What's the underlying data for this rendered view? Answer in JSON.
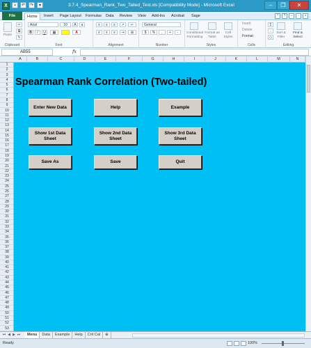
{
  "window": {
    "title": "3.7.4_Spearman_Rank_Two_Tailed_Test.xls  [Compatibility Mode]  -  Microsoft Excel",
    "app_icon": "X",
    "minimize": "–",
    "restore": "❐",
    "close": "✕"
  },
  "ribbon_tabs": [
    "File",
    "Home",
    "Insert",
    "Page Layout",
    "Formulas",
    "Data",
    "Review",
    "View",
    "Add-Ins",
    "Acrobat",
    "Sage"
  ],
  "ribbon": {
    "clipboard": {
      "label": "Clipboard",
      "paste": "Paste"
    },
    "font": {
      "label": "Font",
      "name": "Arial",
      "size": "10"
    },
    "alignment": {
      "label": "Alignment"
    },
    "number": {
      "label": "Number",
      "format": "General",
      "currency": "$",
      "percent": "%"
    },
    "styles": {
      "label": "Styles",
      "conditional": "Conditional\nFormatting",
      "format_table": "Format as\nTable",
      "cell_styles": "Cell\nStyles"
    },
    "cells": {
      "label": "Cells",
      "insert": "Insert",
      "delete": "Delete",
      "format": "Format"
    },
    "editing": {
      "label": "Editing",
      "sort": "Sort &\nFilter",
      "find": "Find &\nSelect"
    }
  },
  "formula_bar": {
    "name_box": "AB55",
    "fx": "fx",
    "value": ""
  },
  "columns": [
    "A",
    "B",
    "C",
    "D",
    "E",
    "F",
    "G",
    "H",
    "I",
    "J",
    "K",
    "L",
    "M",
    "N"
  ],
  "rows": [
    "1",
    "2",
    "3",
    "4",
    "5",
    "6",
    "7",
    "8",
    "9",
    "10",
    "11",
    "12",
    "13",
    "14",
    "15",
    "16",
    "17",
    "18",
    "19",
    "20",
    "21",
    "22",
    "23",
    "24",
    "25",
    "26",
    "27",
    "28",
    "29",
    "30",
    "31",
    "32",
    "33",
    "34",
    "35",
    "36",
    "37",
    "38",
    "39",
    "40",
    "41",
    "42",
    "43",
    "44",
    "45",
    "46",
    "47",
    "48",
    "49",
    "50",
    "51",
    "52",
    "53"
  ],
  "sheet": {
    "title": "Spearman Rank Correlation (Two-tailed)",
    "buttons": {
      "enter_new_data": "Enter New Data",
      "help": "Help",
      "example": "Example",
      "show_1st": "Show 1st Data Sheet",
      "show_2nd": "Show 2nd Data Sheet",
      "show_3rd": "Show 3rd Data Sheet",
      "save_as": "Save As",
      "save": "Save",
      "quit": "Quit"
    },
    "background_color": "#00bff3"
  },
  "sheet_tabs": [
    "Menu",
    "Data",
    "Example",
    "Help",
    "Crit Cal"
  ],
  "active_sheet_tab": "Menu",
  "status": {
    "ready": "Ready",
    "zoom": "100%"
  }
}
